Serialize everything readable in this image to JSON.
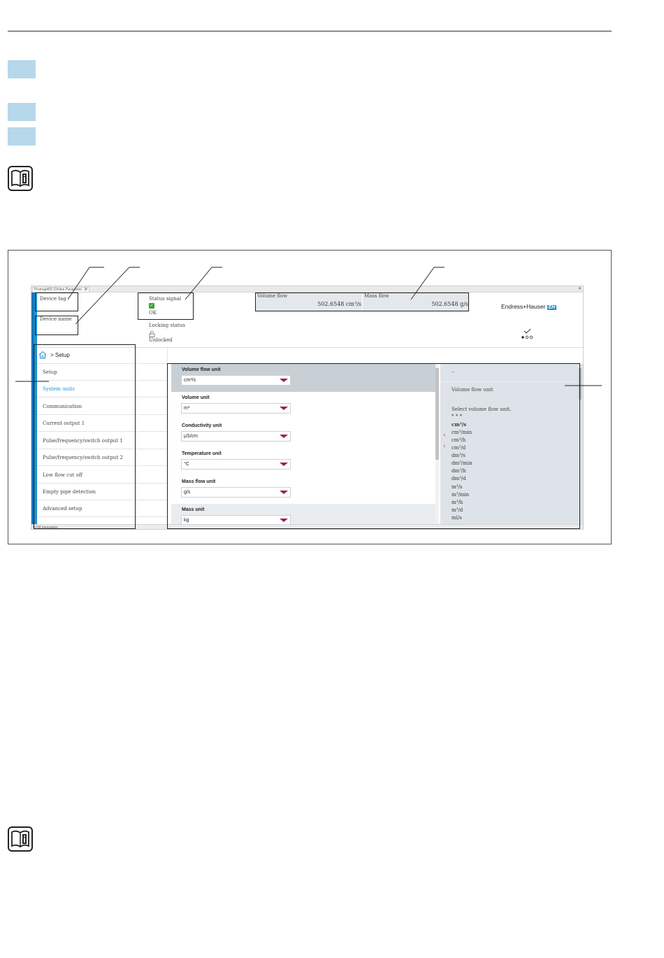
{
  "screen": {
    "tab_title": "Promag400 (Online Parameter...)",
    "tab_close": "✕",
    "window_close": "✕",
    "header": {
      "device_tag_label": "Device tag",
      "device_name_label": "Device name",
      "status_signal_label": "Status signal",
      "status_signal_value": "OK",
      "locking_status_label": "Locking status",
      "locking_status_value": "Unlocked",
      "volume_flow_label": "Volume flow",
      "volume_flow_value": "502.6548 cm³/s",
      "mass_flow_label": "Mass flow",
      "mass_flow_value": "502.6548 g/s",
      "brand": "Endress+Hauser",
      "brand_mark": "EH",
      "colors": {
        "accent": "#1e90d0",
        "dropdown_arrow": "#a3195b",
        "ok": "#3aa63a"
      }
    },
    "navigation": {
      "breadcrumb": "> Setup",
      "items": [
        {
          "label": "Setup",
          "active": false
        },
        {
          "label": "System units",
          "active": true
        },
        {
          "label": "Communication",
          "active": false
        },
        {
          "label": "Current output 1",
          "active": false
        },
        {
          "label": "Pulse/frequency/switch output 1",
          "active": false
        },
        {
          "label": "Pulse/frequency/switch output 2",
          "active": false
        },
        {
          "label": "Low flow cut off",
          "active": false
        },
        {
          "label": "Empty pipe detection",
          "active": false
        },
        {
          "label": "Advanced setup",
          "active": false
        }
      ]
    },
    "parameters": [
      {
        "label": "Volume flow unit",
        "value": "cm³/s"
      },
      {
        "label": "Volume unit",
        "value": "m³"
      },
      {
        "label": "Conductivity unit",
        "value": "µS/cm"
      },
      {
        "label": "Temperature unit",
        "value": "°C"
      },
      {
        "label": "Mass flow unit",
        "value": "g/s"
      },
      {
        "label": "Mass unit",
        "value": "kg"
      }
    ],
    "help": {
      "top_mark": "..",
      "title": "Volume flow unit",
      "description": "Select volume flow unit.",
      "marker": "* * *",
      "options": [
        "cm³/s",
        "cm³/min",
        "cm³/h",
        "cm³/d",
        "dm³/s",
        "dm³/min",
        "dm³/h",
        "dm³/d",
        "m³/s",
        "m³/min",
        "m³/h",
        "m³/d",
        "ml/s"
      ],
      "selected_option": "cm³/s"
    },
    "status_bar": "0 FM messages"
  }
}
